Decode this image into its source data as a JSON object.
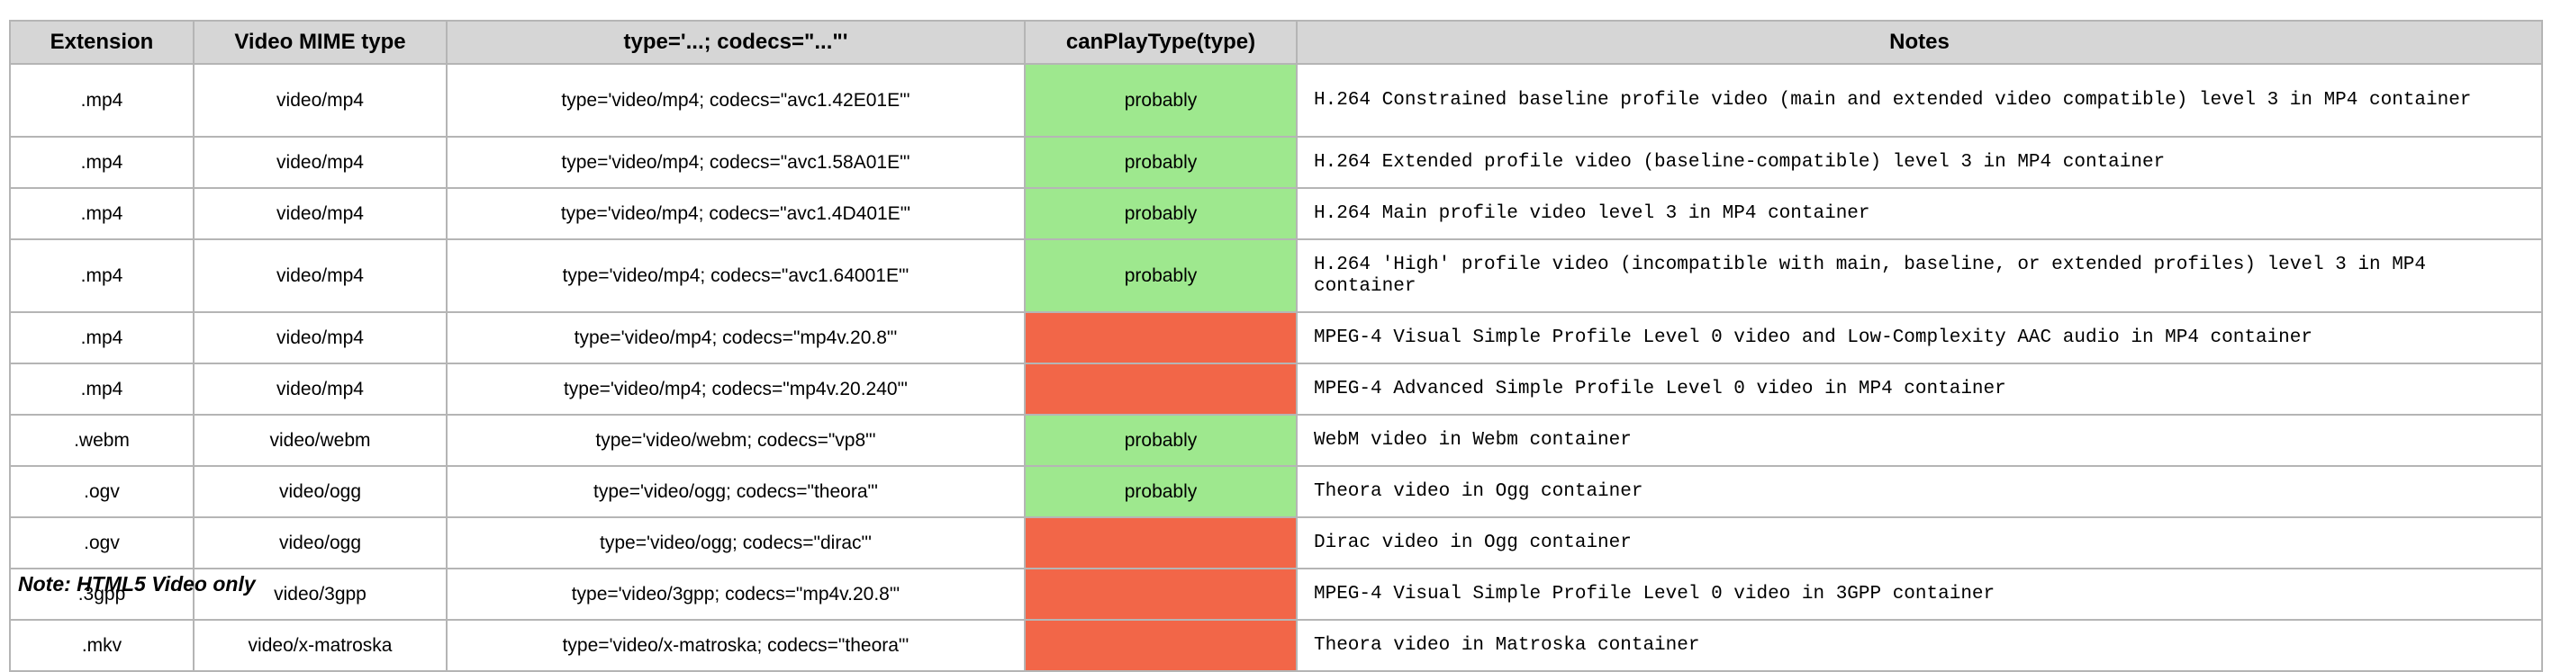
{
  "table": {
    "headers": [
      "Extension",
      "Video MIME type",
      "type='...; codecs=\"...\"'",
      "canPlayType(type)",
      "Notes"
    ],
    "rows": [
      {
        "ext": ".mp4",
        "mime": "video/mp4",
        "type": "type='video/mp4; codecs=\"avc1.42E01E\"'",
        "result": "probably",
        "notes": "H.264 Constrained baseline profile video (main and extended video compatible) level 3 in MP4 container"
      },
      {
        "ext": ".mp4",
        "mime": "video/mp4",
        "type": "type='video/mp4; codecs=\"avc1.58A01E\"'",
        "result": "probably",
        "notes": "H.264 Extended profile video (baseline-compatible) level 3 in MP4 container"
      },
      {
        "ext": ".mp4",
        "mime": "video/mp4",
        "type": "type='video/mp4; codecs=\"avc1.4D401E\"'",
        "result": "probably",
        "notes": "H.264 Main profile video level 3 in MP4 container"
      },
      {
        "ext": ".mp4",
        "mime": "video/mp4",
        "type": "type='video/mp4; codecs=\"avc1.64001E\"'",
        "result": "probably",
        "notes": "H.264 'High' profile video (incompatible with main, baseline, or extended profiles) level 3 in MP4 container"
      },
      {
        "ext": ".mp4",
        "mime": "video/mp4",
        "type": "type='video/mp4; codecs=\"mp4v.20.8\"'",
        "result": "",
        "notes": "MPEG-4 Visual Simple Profile Level 0 video and Low-Complexity AAC audio in MP4 container"
      },
      {
        "ext": ".mp4",
        "mime": "video/mp4",
        "type": "type='video/mp4; codecs=\"mp4v.20.240\"'",
        "result": "",
        "notes": "MPEG-4 Advanced Simple Profile Level 0 video in MP4 container"
      },
      {
        "ext": ".webm",
        "mime": "video/webm",
        "type": "type='video/webm; codecs=\"vp8\"'",
        "result": "probably",
        "notes": "WebM video in Webm container"
      },
      {
        "ext": ".ogv",
        "mime": "video/ogg",
        "type": "type='video/ogg; codecs=\"theora\"'",
        "result": "probably",
        "notes": "Theora video in Ogg container"
      },
      {
        "ext": ".ogv",
        "mime": "video/ogg",
        "type": "type='video/ogg; codecs=\"dirac\"'",
        "result": "",
        "notes": "Dirac video in Ogg container"
      },
      {
        "ext": ".3gpp",
        "mime": "video/3gpp",
        "type": "type='video/3gpp; codecs=\"mp4v.20.8\"'",
        "result": "",
        "notes": "MPEG-4 Visual Simple Profile Level 0 video in 3GPP container"
      },
      {
        "ext": ".mkv",
        "mime": "video/x-matroska",
        "type": "type='video/x-matroska; codecs=\"theora\"'",
        "result": "",
        "notes": "Theora video in Matroska container"
      }
    ]
  },
  "footnote": "Note: HTML5 Video only",
  "colors": {
    "supported": "#9ee88e",
    "unsupported": "#f26648",
    "header_bg": "#d6d6d6",
    "border": "#b5b5b5"
  }
}
